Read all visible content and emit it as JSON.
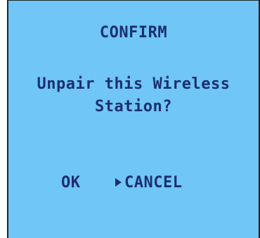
{
  "dialog": {
    "title": "CONFIRM",
    "message_line1": "Unpair this Wireless",
    "message_line2": "Station?"
  },
  "options": {
    "ok_label": "OK",
    "cancel_label": "CANCEL",
    "selected": "CANCEL",
    "pointer_icon": "triangle-right-icon"
  },
  "colors": {
    "background": "#6fc6f7",
    "text": "#1c2f6e",
    "frame": "#222222"
  }
}
